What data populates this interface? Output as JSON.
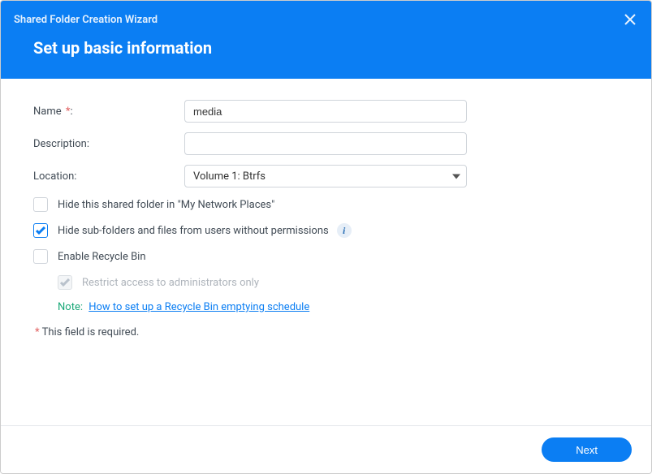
{
  "window": {
    "title": "Shared Folder Creation Wizard",
    "subtitle": "Set up basic information"
  },
  "form": {
    "name": {
      "label": "Name",
      "required_suffix": "*",
      "colon": ":",
      "value": "media",
      "placeholder": ""
    },
    "description": {
      "label": "Description:",
      "value": "",
      "placeholder": ""
    },
    "location": {
      "label": "Location:",
      "selected": "Volume 1:  Btrfs"
    }
  },
  "options": {
    "hide_network": {
      "label": "Hide this shared folder in \"My Network Places\"",
      "checked": false
    },
    "hide_subfolders": {
      "label": "Hide sub-folders and files from users without permissions",
      "checked": true
    },
    "enable_recycle": {
      "label": "Enable Recycle Bin",
      "checked": false
    },
    "restrict_admin": {
      "label": "Restrict access to administrators only",
      "checked": true,
      "disabled": true
    }
  },
  "note": {
    "label": "Note:",
    "link_text": "How to set up a Recycle Bin emptying schedule"
  },
  "required_notice": {
    "star": "*",
    "text": " This field is required."
  },
  "buttons": {
    "next": "Next"
  },
  "info_badge": "i"
}
